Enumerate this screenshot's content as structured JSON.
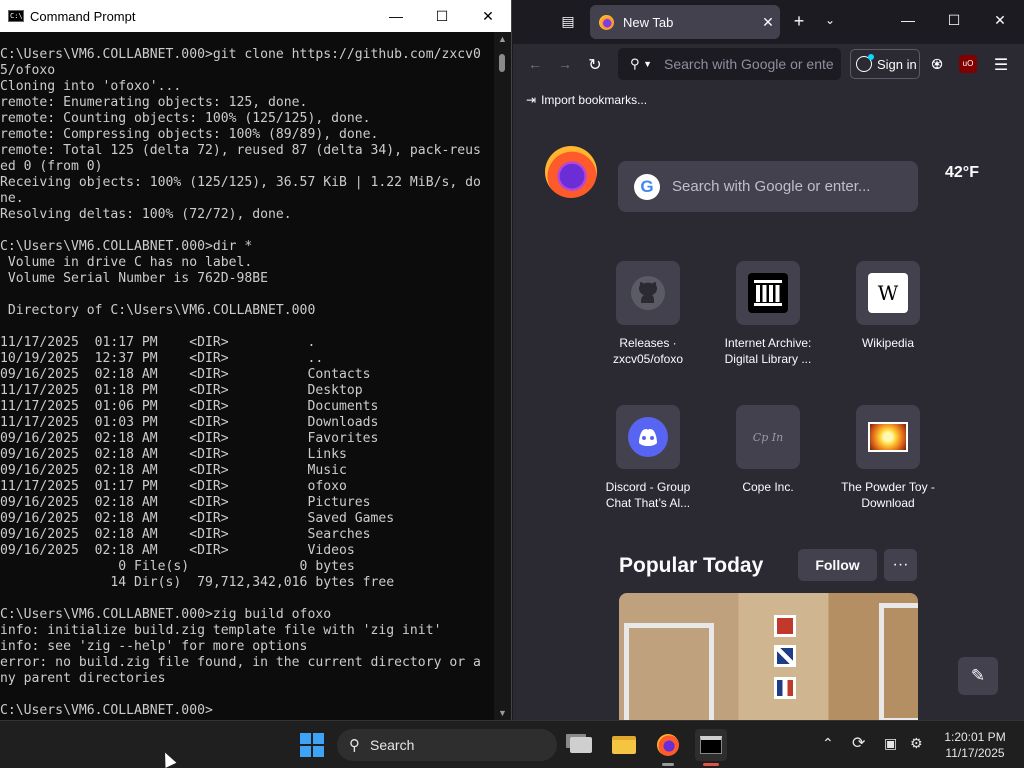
{
  "cmd": {
    "title": "Command Prompt",
    "lines": [
      "C:\\Users\\VM6.COLLABNET.000>git clone https://github.com/zxcv0",
      "5/ofoxo",
      "Cloning into 'ofoxo'...",
      "remote: Enumerating objects: 125, done.",
      "remote: Counting objects: 100% (125/125), done.",
      "remote: Compressing objects: 100% (89/89), done.",
      "remote: Total 125 (delta 72), reused 87 (delta 34), pack-reus",
      "ed 0 (from 0)",
      "Receiving objects: 100% (125/125), 36.57 KiB | 1.22 MiB/s, do",
      "ne.",
      "Resolving deltas: 100% (72/72), done.",
      "",
      "C:\\Users\\VM6.COLLABNET.000>dir *",
      " Volume in drive C has no label.",
      " Volume Serial Number is 762D-98BE",
      "",
      " Directory of C:\\Users\\VM6.COLLABNET.000",
      "",
      "11/17/2025  01:17 PM    <DIR>          .",
      "10/19/2025  12:37 PM    <DIR>          ..",
      "09/16/2025  02:18 AM    <DIR>          Contacts",
      "11/17/2025  01:18 PM    <DIR>          Desktop",
      "11/17/2025  01:06 PM    <DIR>          Documents",
      "11/17/2025  01:03 PM    <DIR>          Downloads",
      "09/16/2025  02:18 AM    <DIR>          Favorites",
      "09/16/2025  02:18 AM    <DIR>          Links",
      "09/16/2025  02:18 AM    <DIR>          Music",
      "11/17/2025  01:17 PM    <DIR>          ofoxo",
      "09/16/2025  02:18 AM    <DIR>          Pictures",
      "09/16/2025  02:18 AM    <DIR>          Saved Games",
      "09/16/2025  02:18 AM    <DIR>          Searches",
      "09/16/2025  02:18 AM    <DIR>          Videos",
      "               0 File(s)              0 bytes",
      "              14 Dir(s)  79,712,342,016 bytes free",
      "",
      "C:\\Users\\VM6.COLLABNET.000>zig build ofoxo",
      "info: initialize build.zig template file with 'zig init'",
      "info: see 'zig --help' for more options",
      "error: no build.zig file found, in the current directory or a",
      "ny parent directories",
      "",
      "C:\\Users\\VM6.COLLABNET.000>"
    ]
  },
  "firefox": {
    "tab_title": "New Tab",
    "url_placeholder": "Search with Google or ente",
    "signin_label": "Sign in",
    "import_bookmarks": "Import bookmarks...",
    "search_placeholder": "Search with Google or enter...",
    "weather": "42°F",
    "shortcuts": [
      {
        "label": "Releases · zxcv05/ofoxo",
        "icon": "github-icon"
      },
      {
        "label": "Internet Archive: Digital Library ...",
        "icon": "internet-archive-icon"
      },
      {
        "label": "Wikipedia",
        "icon": "wikipedia-icon",
        "glyph": "W"
      },
      {
        "label": "Discord - Group Chat That’s Al...",
        "icon": "discord-icon"
      },
      {
        "label": "Cope Inc.",
        "icon": "cope-inc-icon",
        "glyph": "Cp In"
      },
      {
        "label": "The Powder Toy - Download",
        "icon": "powder-toy-icon"
      }
    ],
    "popular_title": "Popular Today",
    "follow_label": "Follow",
    "more_glyph": "···"
  },
  "taskbar": {
    "search_label": "Search",
    "time": "1:20:01 PM",
    "date": "11/17/2025",
    "accent": "#3ea2f5"
  }
}
